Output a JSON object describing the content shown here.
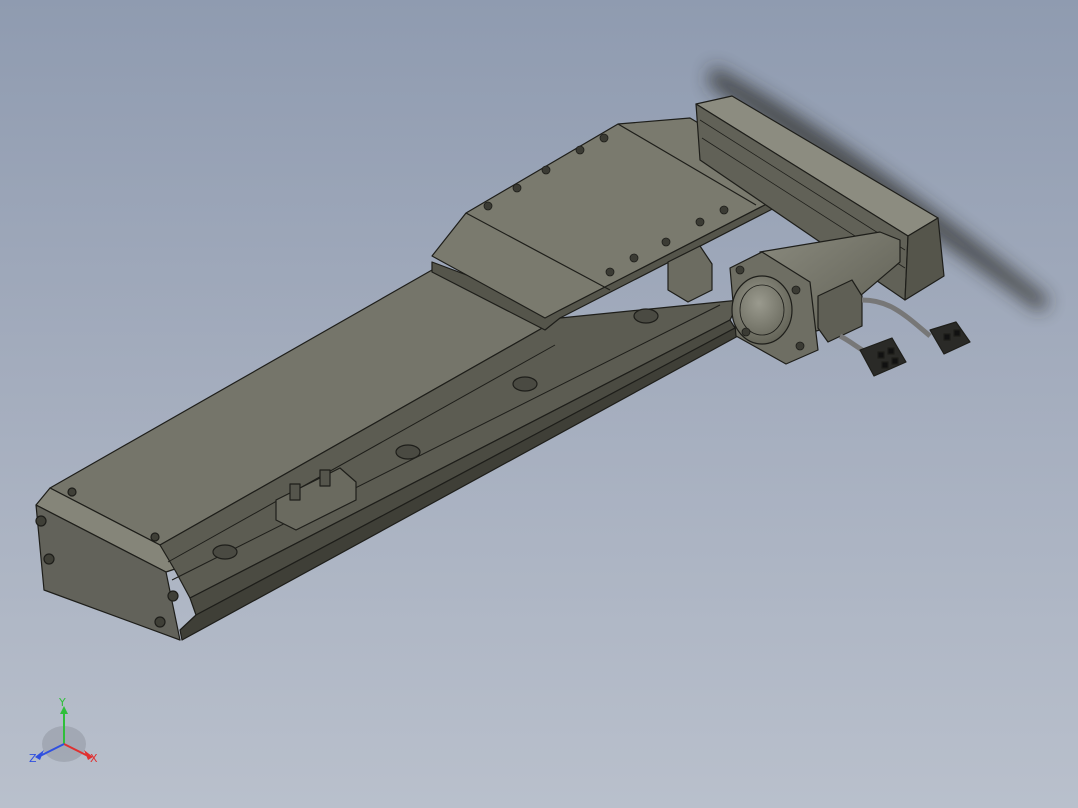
{
  "viewport": {
    "background_top": "#8f9bb0",
    "background_bottom": "#b9c0cc"
  },
  "part_colors": {
    "body": "#6f6f62",
    "body_dark": "#4e4e44",
    "body_light": "#85857a",
    "edge": "#1e1e1a"
  },
  "triad": {
    "x_label": "X",
    "y_label": "Y",
    "z_label": "Z",
    "x_color": "#e03030",
    "y_color": "#2fbf3a",
    "z_color": "#3050e0"
  }
}
